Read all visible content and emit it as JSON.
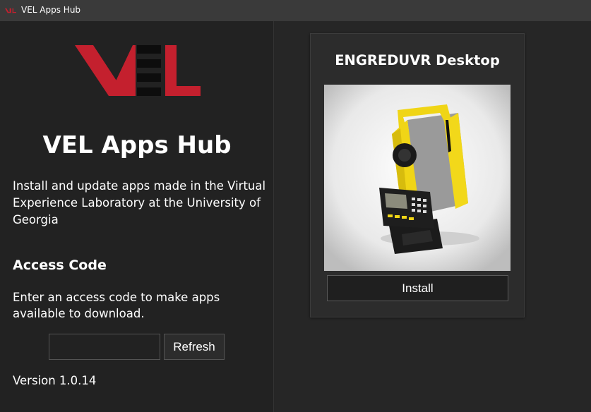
{
  "window": {
    "title": "VEL Apps Hub",
    "icon": "vel-logo-icon"
  },
  "sidebar": {
    "logo": "vel-logo",
    "hub_title": "VEL Apps Hub",
    "description": "Install and update apps made in the Virtual Experience Laboratory at the University of Georgia",
    "access_code": {
      "heading": "Access Code",
      "description": "Enter an access code to make apps available to download.",
      "input_value": "",
      "input_placeholder": "",
      "refresh_label": "Refresh"
    },
    "version": "Version 1.0.14"
  },
  "apps": [
    {
      "name": "ENGREDUVR Desktop",
      "image": "total-station-surveying-instrument",
      "install_label": "Install"
    }
  ],
  "colors": {
    "brand_red": "#c4202e",
    "titlebar": "#3a3a3a",
    "sidebar_bg": "#222222",
    "main_bg": "#262626",
    "card_bg": "#2c2c2c",
    "instrument_yellow": "#f0d516"
  }
}
